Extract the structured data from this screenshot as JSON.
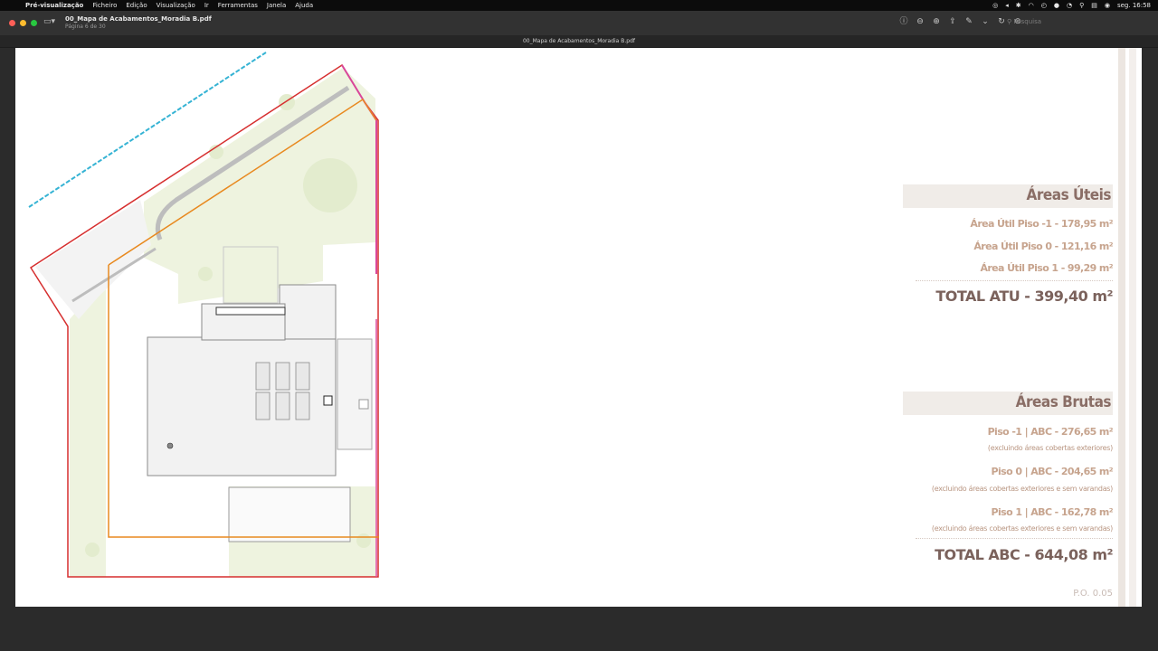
{
  "menubar": {
    "app": "Pré-visualização",
    "items": [
      "Ficheiro",
      "Edição",
      "Visualização",
      "Ir",
      "Ferramentas",
      "Janela",
      "Ajuda"
    ],
    "clock": "seg. 16:58"
  },
  "window": {
    "title": "00_Mapa de Acabamentos_Moradia B.pdf",
    "subtitle": "Página 6 de 30",
    "tab_title": "00_Mapa de Acabamentos_Moradia B.pdf",
    "search_placeholder": "Pesquisa"
  },
  "areas_uteis": {
    "heading": "Áreas Úteis",
    "rows": [
      "Área Útil Piso -1  -  178,95 m²",
      "Área Útil Piso 0  -  121,16 m²",
      "Área Útil Piso 1  -  99,29 m²"
    ],
    "total": "TOTAL  ATU - 399,40 m²"
  },
  "areas_brutas": {
    "heading": "Áreas Brutas",
    "rows": [
      {
        "label": "Piso -1 | ABC - 276,65 m²",
        "note": "(excluindo áreas cobertas exteriores)"
      },
      {
        "label": "Piso 0 | ABC - 204,65 m²",
        "note": "(excluindo áreas cobertas exteriores e sem varandas)"
      },
      {
        "label": "Piso 1 | ABC - 162,78 m²",
        "note": "(excluindo áreas cobertas exteriores e sem varandas)"
      }
    ],
    "total": "TOTAL  ABC - 644,08 m²"
  },
  "page_number": "P.O. 0.05",
  "colors": {
    "heading": "#8a6e66",
    "row": "#c7a48e",
    "total": "#7b625c",
    "boundary_red": "#d62f2f",
    "boundary_orange": "#e8891f",
    "boundary_magenta": "#d9479a",
    "water_line": "#35b3d4"
  }
}
